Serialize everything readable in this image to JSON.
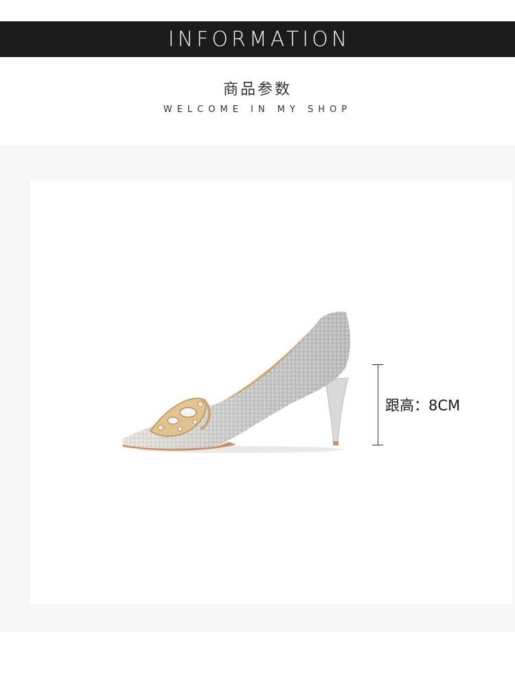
{
  "header": {
    "banner_title": "INFORMATION",
    "subtitle_cn": "商品参数",
    "subtitle_en": "WELCOME IN MY SHOP"
  },
  "product": {
    "heel_height_label": "跟高：8CM"
  },
  "colors": {
    "banner_bg": "#1b1b1b",
    "banner_text": "#f2f2f2",
    "panel_bg": "#f7f7f7",
    "card_bg": "#ffffff"
  }
}
